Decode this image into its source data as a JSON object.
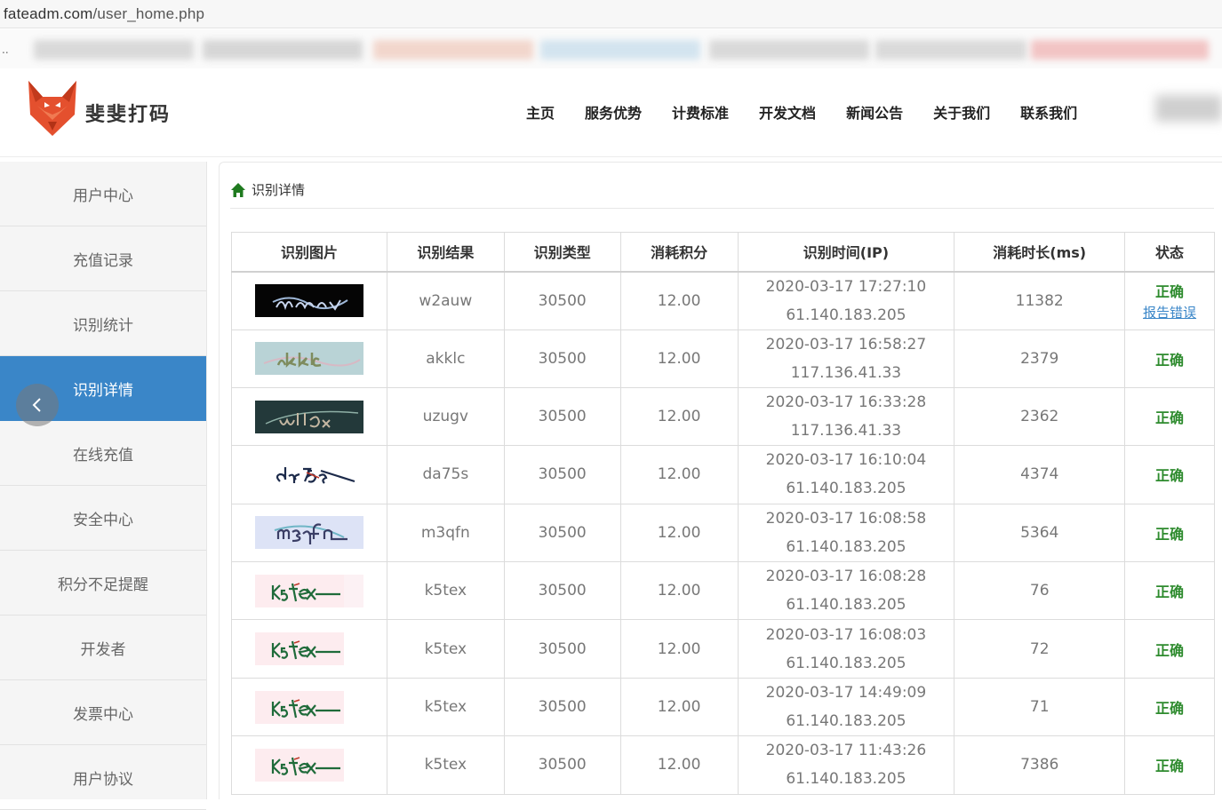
{
  "browser": {
    "url_host": "fateadm.com",
    "url_path": "/user_home.php"
  },
  "header": {
    "brand": "斐斐打码",
    "nav": [
      "主页",
      "服务优势",
      "计费标准",
      "开发文档",
      "新闻公告",
      "关于我们",
      "联系我们"
    ]
  },
  "sidebar": {
    "items": [
      "用户中心",
      "充值记录",
      "识别统计",
      "识别详情",
      "在线充值",
      "安全中心",
      "积分不足提醒",
      "开发者",
      "发票中心",
      "用户协议"
    ],
    "active_index": 3
  },
  "breadcrumb": "识别详情",
  "table": {
    "headers": [
      "识别图片",
      "识别结果",
      "识别类型",
      "消耗积分",
      "识别时间(IP)",
      "消耗时长(ms)",
      "状态"
    ],
    "rows": [
      {
        "result": "w2auw",
        "type": "30500",
        "cost": "12.00",
        "time": "2020-03-17 17:27:10",
        "ip": "61.140.183.205",
        "duration": "11382",
        "status": "正确",
        "report": "报告错误"
      },
      {
        "result": "akklc",
        "type": "30500",
        "cost": "12.00",
        "time": "2020-03-17 16:58:27",
        "ip": "117.136.41.33",
        "duration": "2379",
        "status": "正确"
      },
      {
        "result": "uzugv",
        "type": "30500",
        "cost": "12.00",
        "time": "2020-03-17 16:33:28",
        "ip": "117.136.41.33",
        "duration": "2362",
        "status": "正确"
      },
      {
        "result": "da75s",
        "type": "30500",
        "cost": "12.00",
        "time": "2020-03-17 16:10:04",
        "ip": "61.140.183.205",
        "duration": "4374",
        "status": "正确"
      },
      {
        "result": "m3qfn",
        "type": "30500",
        "cost": "12.00",
        "time": "2020-03-17 16:08:58",
        "ip": "61.140.183.205",
        "duration": "5364",
        "status": "正确"
      },
      {
        "result": "k5tex",
        "type": "30500",
        "cost": "12.00",
        "time": "2020-03-17 16:08:28",
        "ip": "61.140.183.205",
        "duration": "76",
        "status": "正确"
      },
      {
        "result": "k5tex",
        "type": "30500",
        "cost": "12.00",
        "time": "2020-03-17 16:08:03",
        "ip": "61.140.183.205",
        "duration": "72",
        "status": "正确"
      },
      {
        "result": "k5tex",
        "type": "30500",
        "cost": "12.00",
        "time": "2020-03-17 14:49:09",
        "ip": "61.140.183.205",
        "duration": "71",
        "status": "正确"
      },
      {
        "result": "k5tex",
        "type": "30500",
        "cost": "12.00",
        "time": "2020-03-17 11:43:26",
        "ip": "61.140.183.205",
        "duration": "7386",
        "status": "正确"
      }
    ]
  },
  "colors": {
    "accent": "#3a86c8",
    "ok": "#2e8b2e"
  }
}
